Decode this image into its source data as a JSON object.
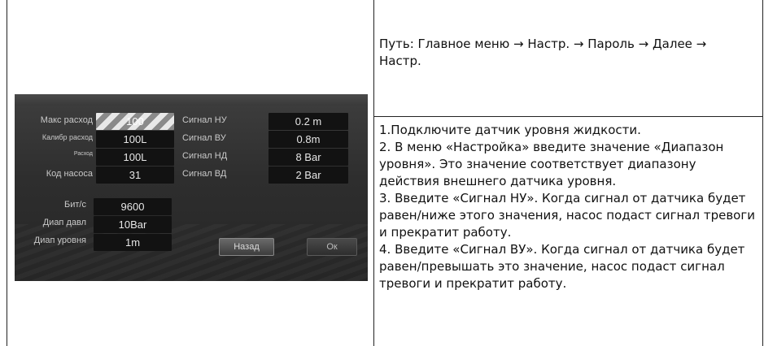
{
  "path": "Путь: Главное меню → Настр. → Пароль → Далее → Настр.",
  "instructions": [
    "1.Подключите датчик уровня жидкости.",
    "2. В меню «Настройка» введите значение «Диапазон уровня». Это значение соответствует диапазону действия внешнего датчика уровня.",
    "3. Введите «Сигнал НУ». Когда сигнал от датчика будет равен/ниже этого значения, насос подаст сигнал тревоги и прекратит работу.",
    "4. Введите «Сигнал ВУ». Когда сигнал от датчика будет равен/превышать это значение, насос подаст сигнал тревоги и прекратит работу."
  ],
  "device": {
    "left_fields": [
      {
        "label": "Макс расход",
        "value": "100"
      },
      {
        "label": "Калибр расход",
        "value": "100L"
      },
      {
        "label": "Расход",
        "value": "100L"
      },
      {
        "label": "Код насоса",
        "value": "31"
      }
    ],
    "right_fields": [
      {
        "label": "Сигнал НУ",
        "value": "0.2 m"
      },
      {
        "label": "Сигнал ВУ",
        "value": "0.8m"
      },
      {
        "label": "Сигнал НД",
        "value": "8 Bar"
      },
      {
        "label": "Сигнал ВД",
        "value": "2 Bar"
      }
    ],
    "bottom_fields": [
      {
        "label": "Бит/с",
        "value": "9600"
      },
      {
        "label": "Диап давл",
        "value": "10Bar"
      },
      {
        "label": "Диап уровня",
        "value": "1m"
      }
    ],
    "back_button": "Назад",
    "ok_button": "Ок"
  }
}
